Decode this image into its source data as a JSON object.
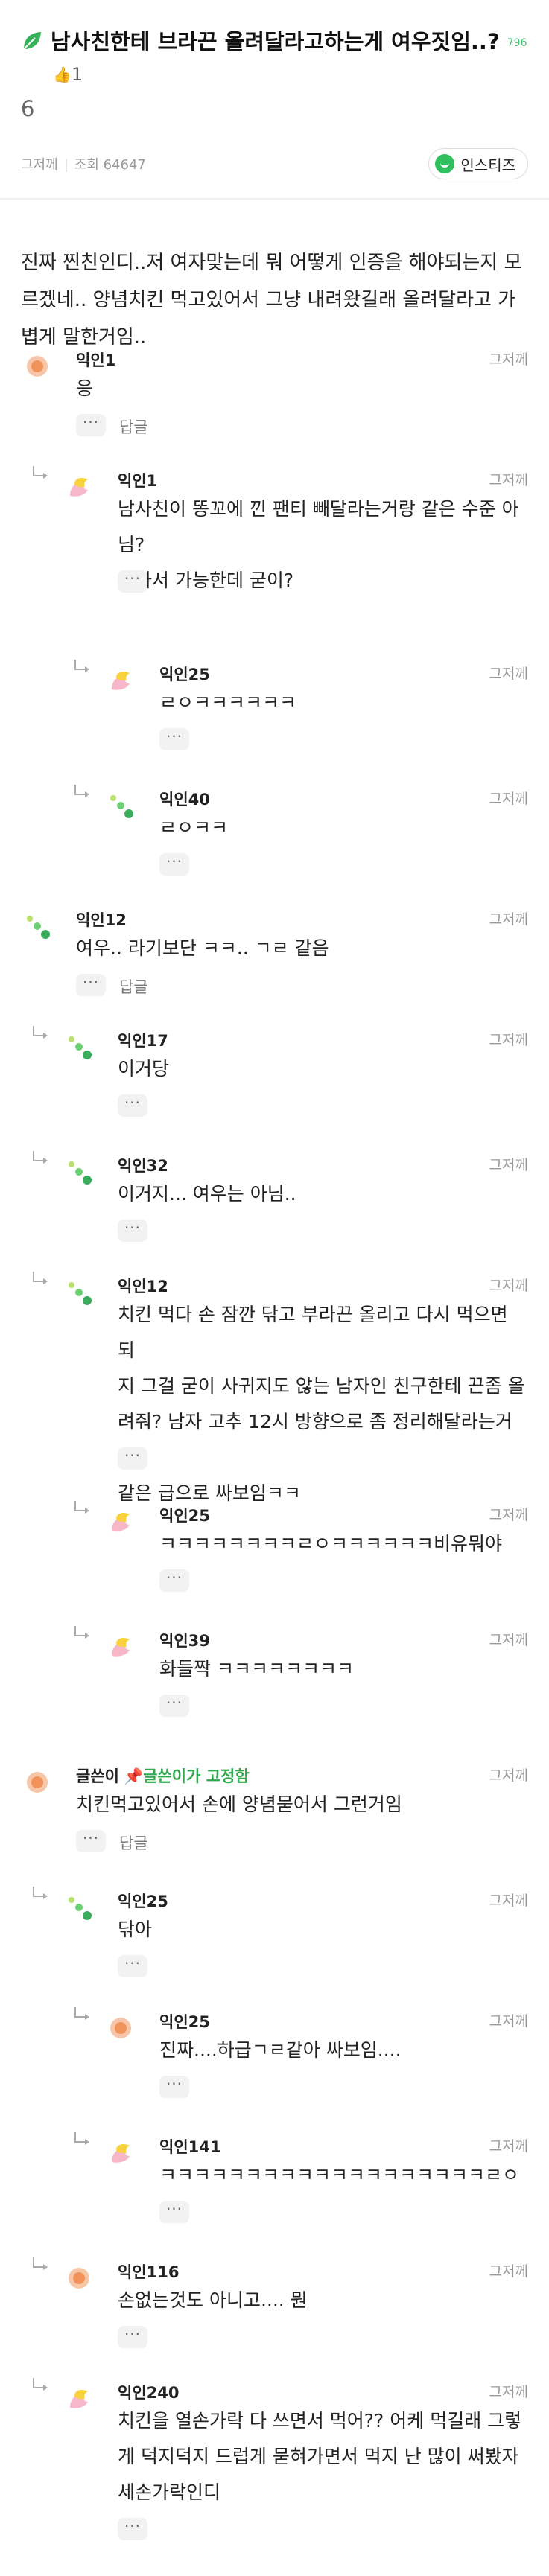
{
  "post": {
    "title": "남사친한테 브라끈 올려달라고하는게 여우짓임..?",
    "views_badge": "796",
    "likes": "1",
    "title_cont": "6",
    "author": "그저께",
    "views": "조회 64647",
    "share_label": "인스티즈",
    "body": "진짜 찐친인디..저 여자맞는데 뭐 어떻게 인증을 해야되는지 모르겠네.. 양념치킨 먹고있어서 그냥 내려왔길래 올려달라고 가볍게 말한거임.."
  },
  "ui": {
    "more": "···",
    "reply": "답글",
    "pinned": "글쓴이가 고정함"
  },
  "comments": [
    {
      "nick": "익인1",
      "time": "그저께",
      "lines": [
        "응"
      ],
      "reply": true
    },
    {
      "nick": "익인1",
      "time": "그저께",
      "lines": [
        "남사친이 똥꼬에 낀 팬티 빼달라는거랑 같은 수준 아님?",
        "혼자서 가능한데 굳이?"
      ]
    },
    {
      "nick": "익인25",
      "time": "그저께",
      "lines": [
        "ㄹㅇㅋㅋㅋㅋㅋㅋ"
      ]
    },
    {
      "nick": "익인40",
      "time": "그저께",
      "lines": [
        "ㄹㅇㅋㅋ"
      ]
    },
    {
      "nick": "익인12",
      "time": "그저께",
      "lines": [
        "여우.. 라기보단 ㅋㅋ.. ㄱㄹ 같음"
      ],
      "reply": true
    },
    {
      "nick": "익인17",
      "time": "그저께",
      "lines": [
        "이거당"
      ]
    },
    {
      "nick": "익인32",
      "time": "그저께",
      "lines": [
        "이거지... 여우는 아님.."
      ]
    },
    {
      "nick": "익인12",
      "time": "그저께",
      "lines": [
        "치킨 먹다 손 잠깐 닦고 부라끈 올리고 다시 먹으면 되",
        "지 그걸 굳이 사귀지도 않는 남자인 친구한테 끈좀 올",
        "려줘? 남자 고추 12시 방향으로 좀 정리해달라는거랑",
        "같은 급으로 싸보임ㅋㅋ"
      ]
    },
    {
      "nick": "익인25",
      "time": "그저께",
      "lines": [
        "ㅋㅋㅋㅋㅋㅋㅋㅋㄹㅇㅋㅋㅋㅋㅋㅋ비유뭐야"
      ]
    },
    {
      "nick": "익인39",
      "time": "그저께",
      "lines": [
        "화들짝 ㅋㅋㅋㅋㅋㅋㅋㅋ"
      ]
    },
    {
      "nick": "글쓴이",
      "time": "그저께",
      "lines": [
        "치킨먹고있어서 손에 양념묻어서 그런거임"
      ],
      "reply": true,
      "pinned": true
    },
    {
      "nick": "익인25",
      "time": "그저께",
      "lines": [
        "닦아"
      ]
    },
    {
      "nick": "익인25",
      "time": "그저께",
      "lines": [
        "진짜....하급ㄱㄹ같아 싸보임...."
      ]
    },
    {
      "nick": "익인141",
      "time": "그저께",
      "lines": [
        "ㅋㅋㅋㅋㅋㅋㅋㅋㅋㅋㅋㅋㅋㅋㅋㅋㅋㅋㅋㄹㅇ"
      ]
    },
    {
      "nick": "익인116",
      "time": "그저께",
      "lines": [
        "손없는것도 아니고.... 뭔"
      ]
    },
    {
      "nick": "익인240",
      "time": "그저께",
      "lines": [
        "치킨을 열손가락 다 쓰면서 먹어?? 어케 먹길래 그렇",
        "게 덕지덕지 드럽게 묻혀가면서 먹지 난 많이 써봤자",
        "세손가락인디"
      ]
    }
  ]
}
